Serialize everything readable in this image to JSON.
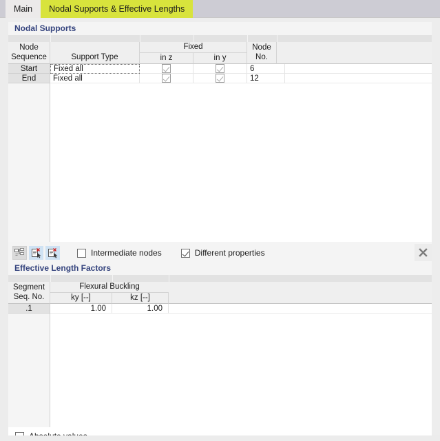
{
  "tabs": [
    {
      "label": "Main",
      "active": false
    },
    {
      "label": "Nodal Supports & Effective Lengths",
      "active": true
    }
  ],
  "colors": {
    "active_tab_bg": "#d8e33c",
    "tabstrip_bg": "#cdccd4",
    "section_title_fg": "#35447e",
    "grid_header_bg": "#efefef",
    "row_header_bg": "#e2e2e2"
  },
  "nodal_supports": {
    "title": "Nodal Supports",
    "headers": {
      "row_seq_line1": "Node",
      "row_seq_line2": "Sequence",
      "support_type": "Support Type",
      "fixed_group": "Fixed",
      "in_z": "in z",
      "in_y": "in y",
      "node_no_line1": "Node",
      "node_no_line2": "No."
    },
    "rows": [
      {
        "sequence": "Start",
        "support_type": "Fixed all",
        "fixed_in_z": true,
        "fixed_in_y": true,
        "node_no": "6",
        "focused": true
      },
      {
        "sequence": "End",
        "support_type": "Fixed all",
        "fixed_in_z": true,
        "fixed_in_y": true,
        "node_no": "12",
        "focused": false
      }
    ],
    "toolbar": {
      "buttons": [
        {
          "icon": "tree-hierarchy-icon",
          "state": "pressed"
        },
        {
          "icon": "document-delete-cursor-icon",
          "state": "blue"
        },
        {
          "icon": "document-delete-cursor-icon",
          "state": "blue"
        }
      ],
      "intermediate_nodes": {
        "label": "Intermediate nodes",
        "checked": false
      },
      "different_properties": {
        "label": "Different properties",
        "checked": true
      },
      "delete_button": {
        "icon": "close-x-icon"
      }
    }
  },
  "effective_length_factors": {
    "title": "Effective Length Factors",
    "headers": {
      "row_seq_line1": "Segment",
      "row_seq_line2": "Seq. No.",
      "group": "Flexural Buckling",
      "ky": "ky [--]",
      "kz": "kz [--]"
    },
    "rows": [
      {
        "sequence": ".1",
        "ky": "1.00",
        "kz": "1.00"
      }
    ],
    "absolute_values": {
      "label": "Absolute values",
      "checked": false
    }
  }
}
